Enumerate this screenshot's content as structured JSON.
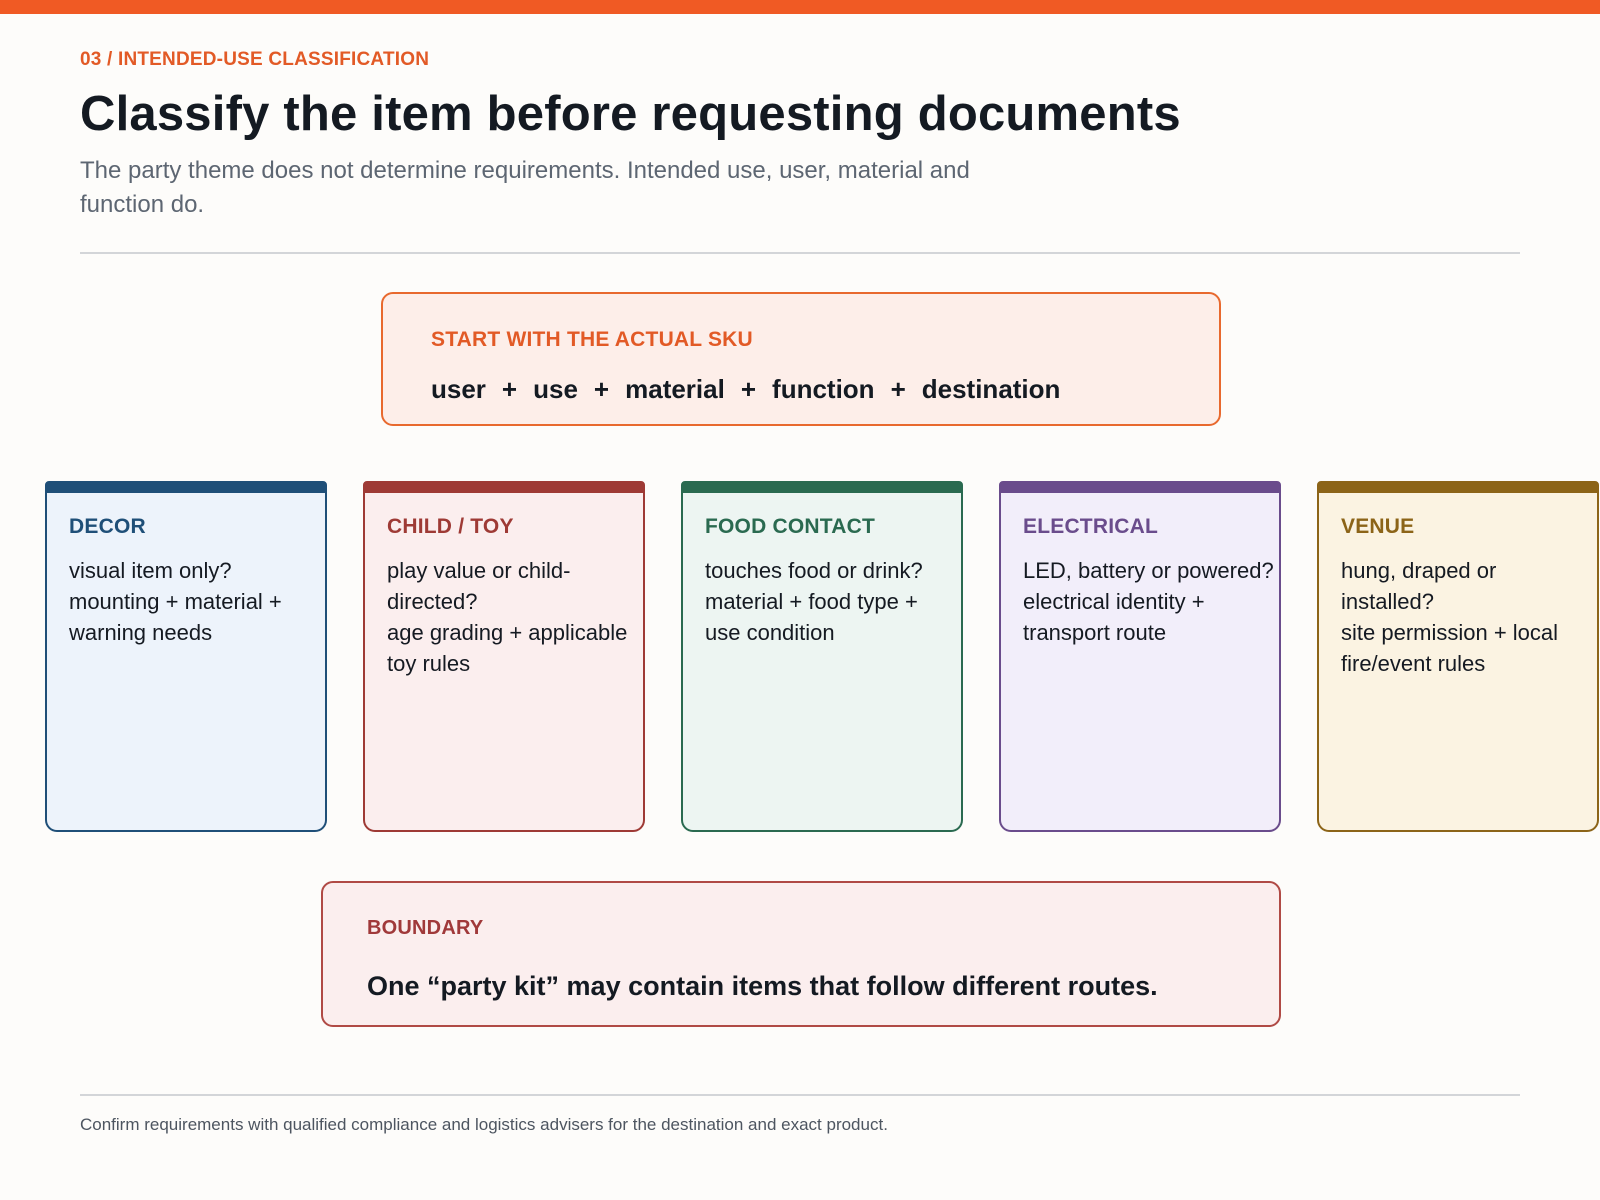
{
  "header": {
    "eyebrow": "03 / INTENDED-USE CLASSIFICATION",
    "title": "Classify the item before requesting documents",
    "subtitle": "The party theme does not determine requirements. Intended use, user, material and function do."
  },
  "start": {
    "label": "START WITH THE ACTUAL SKU",
    "terms": [
      "user",
      "use",
      "material",
      "function",
      "destination"
    ],
    "operator": "+"
  },
  "categories": [
    {
      "title": "DECOR",
      "question": "visual item only?",
      "need": "mounting + material + warning needs",
      "color": "#1f4f78"
    },
    {
      "title": "CHILD / TOY",
      "question": "play value or child-directed?",
      "need": "age grading + applicable toy rules",
      "color": "#9e3a35"
    },
    {
      "title": "FOOD CONTACT",
      "question": "touches food or drink?",
      "need": "material + food type + use condition",
      "color": "#2a6a50"
    },
    {
      "title": "ELECTRICAL",
      "question": "LED, battery or powered?",
      "need": "electrical identity + transport route",
      "color": "#6a4c8c"
    },
    {
      "title": "VENUE",
      "question": "hung, draped or installed?",
      "need": "site permission + local fire/event rules",
      "color": "#8c6418"
    }
  ],
  "boundary": {
    "label": "BOUNDARY",
    "text": "One “party kit” may contain items that follow different routes."
  },
  "footer": {
    "note": "Confirm requirements with qualified compliance and logistics advisers for the destination and exact product."
  },
  "colors": {
    "accent": "#f05a24",
    "boundary": "#b04a45"
  }
}
